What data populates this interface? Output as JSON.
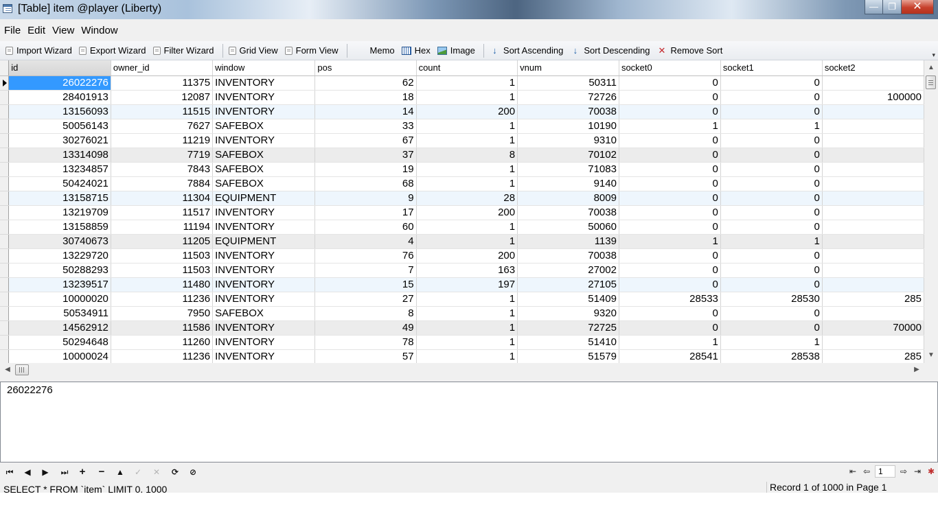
{
  "window": {
    "title": "[Table] item @player (Liberty)",
    "minimize_glyph": "—",
    "maximize_glyph": "❐",
    "close_glyph": "✕"
  },
  "menu": [
    "File",
    "Edit",
    "View",
    "Window"
  ],
  "toolbar": [
    {
      "label": "Import Wizard",
      "icon": "import-wizard-icon"
    },
    {
      "label": "Export Wizard",
      "icon": "export-wizard-icon"
    },
    {
      "label": "Filter Wizard",
      "icon": "filter-wizard-icon"
    },
    {
      "label": "Grid View",
      "icon": "grid-view-icon"
    },
    {
      "label": "Form View",
      "icon": "form-view-icon"
    },
    {
      "label": "Memo",
      "icon": "memo-icon"
    },
    {
      "label": "Hex",
      "icon": "hex-icon"
    },
    {
      "label": "Image",
      "icon": "image-icon"
    },
    {
      "label": "Sort Ascending",
      "icon": "sort-ascending-icon"
    },
    {
      "label": "Sort Descending",
      "icon": "sort-descending-icon"
    },
    {
      "label": "Remove Sort",
      "icon": "remove-sort-icon"
    }
  ],
  "grid": {
    "columns": [
      "id",
      "owner_id",
      "window",
      "pos",
      "count",
      "vnum",
      "socket0",
      "socket1",
      "socket2"
    ],
    "rows": [
      [
        "26022276",
        "11375",
        "INVENTORY",
        "62",
        "1",
        "50311",
        "0",
        "0",
        ""
      ],
      [
        "28401913",
        "12087",
        "INVENTORY",
        "18",
        "1",
        "72726",
        "0",
        "0",
        "100000"
      ],
      [
        "13156093",
        "11515",
        "INVENTORY",
        "14",
        "200",
        "70038",
        "0",
        "0",
        ""
      ],
      [
        "50056143",
        "7627",
        "SAFEBOX",
        "33",
        "1",
        "10190",
        "1",
        "1",
        ""
      ],
      [
        "30276021",
        "11219",
        "INVENTORY",
        "67",
        "1",
        "9310",
        "0",
        "0",
        ""
      ],
      [
        "13314098",
        "7719",
        "SAFEBOX",
        "37",
        "8",
        "70102",
        "0",
        "0",
        ""
      ],
      [
        "13234857",
        "7843",
        "SAFEBOX",
        "19",
        "1",
        "71083",
        "0",
        "0",
        ""
      ],
      [
        "50424021",
        "7884",
        "SAFEBOX",
        "68",
        "1",
        "9140",
        "0",
        "0",
        ""
      ],
      [
        "13158715",
        "11304",
        "EQUIPMENT",
        "9",
        "28",
        "8009",
        "0",
        "0",
        ""
      ],
      [
        "13219709",
        "11517",
        "INVENTORY",
        "17",
        "200",
        "70038",
        "0",
        "0",
        ""
      ],
      [
        "13158859",
        "11194",
        "INVENTORY",
        "60",
        "1",
        "50060",
        "0",
        "0",
        ""
      ],
      [
        "30740673",
        "11205",
        "EQUIPMENT",
        "4",
        "1",
        "1139",
        "1",
        "1",
        ""
      ],
      [
        "13229720",
        "11503",
        "INVENTORY",
        "76",
        "200",
        "70038",
        "0",
        "0",
        ""
      ],
      [
        "50288293",
        "11503",
        "INVENTORY",
        "7",
        "163",
        "27002",
        "0",
        "0",
        ""
      ],
      [
        "13239517",
        "11480",
        "INVENTORY",
        "15",
        "197",
        "27105",
        "0",
        "0",
        ""
      ],
      [
        "10000020",
        "11236",
        "INVENTORY",
        "27",
        "1",
        "51409",
        "28533",
        "28530",
        "285"
      ],
      [
        "50534911",
        "7950",
        "SAFEBOX",
        "8",
        "1",
        "9320",
        "0",
        "0",
        ""
      ],
      [
        "14562912",
        "11586",
        "INVENTORY",
        "49",
        "1",
        "72725",
        "0",
        "0",
        "70000"
      ],
      [
        "50294648",
        "11260",
        "INVENTORY",
        "78",
        "1",
        "51410",
        "1",
        "1",
        ""
      ],
      [
        "10000024",
        "11236",
        "INVENTORY",
        "57",
        "1",
        "51579",
        "28541",
        "28538",
        "285"
      ]
    ]
  },
  "memo": {
    "value": "26022276"
  },
  "navigator": {
    "first": "⏮",
    "prev": "◀",
    "next": "▶",
    "last": "⏭",
    "insert": "+",
    "delete": "−",
    "edit": "▲",
    "post": "✓",
    "cancel": "✕",
    "refresh": "⟳",
    "stop": "⊘"
  },
  "pager": {
    "page": "1"
  },
  "status": {
    "sql": "SELECT * FROM `item` LIMIT 0, 1000",
    "record": "Record 1 of 1000 in Page 1"
  }
}
